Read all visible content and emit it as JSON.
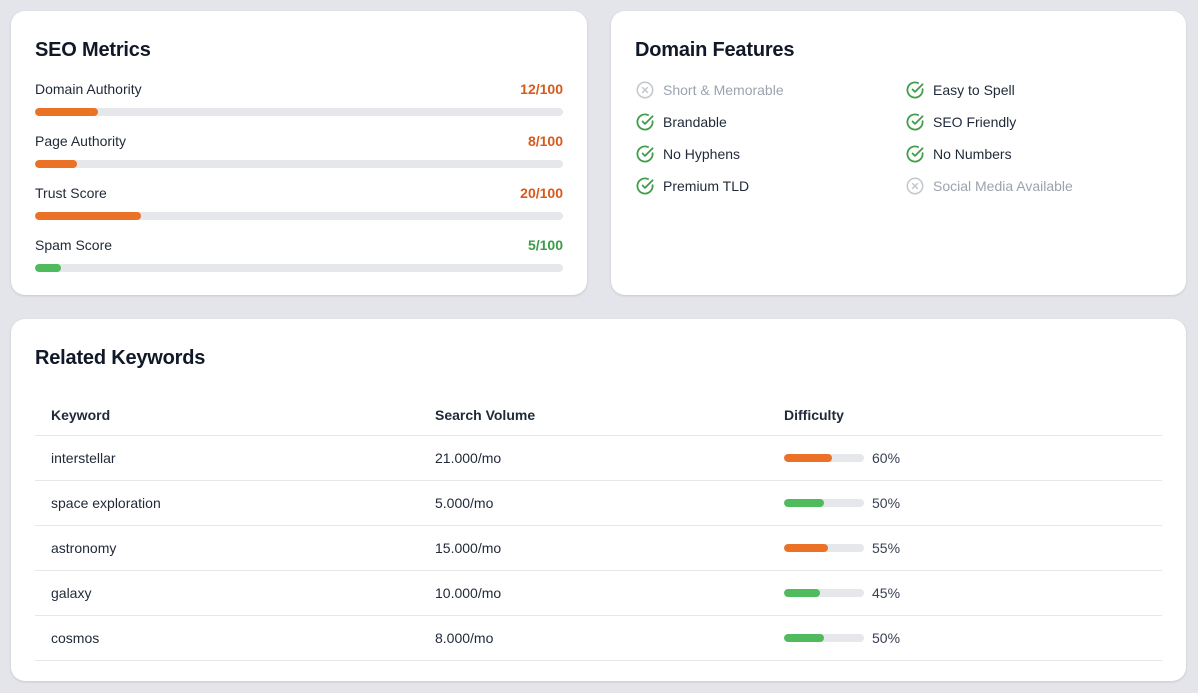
{
  "colors": {
    "orange": "#ea7125",
    "green": "#4fbb5c",
    "value_orange": "#d9591a",
    "value_green": "#3b9b47",
    "check_green": "#3f9e4a",
    "x_gray": "#c3c6cc"
  },
  "seo": {
    "title": "SEO Metrics",
    "metrics": [
      {
        "label": "Domain Authority",
        "value_text": "12/100",
        "value": 12,
        "status": "orange"
      },
      {
        "label": "Page Authority",
        "value_text": "8/100",
        "value": 8,
        "status": "orange"
      },
      {
        "label": "Trust Score",
        "value_text": "20/100",
        "value": 20,
        "status": "orange"
      },
      {
        "label": "Spam Score",
        "value_text": "5/100",
        "value": 5,
        "status": "green"
      }
    ]
  },
  "features": {
    "title": "Domain Features",
    "items": [
      {
        "label": "Short & Memorable",
        "available": false,
        "icon": "x-circle-icon"
      },
      {
        "label": "Easy to Spell",
        "available": true,
        "icon": "check-circle-icon"
      },
      {
        "label": "Brandable",
        "available": true,
        "icon": "check-circle-icon"
      },
      {
        "label": "SEO Friendly",
        "available": true,
        "icon": "check-circle-icon"
      },
      {
        "label": "No Hyphens",
        "available": true,
        "icon": "check-circle-icon"
      },
      {
        "label": "No Numbers",
        "available": true,
        "icon": "check-circle-icon"
      },
      {
        "label": "Premium TLD",
        "available": true,
        "icon": "check-circle-icon"
      },
      {
        "label": "Social Media Available",
        "available": false,
        "icon": "x-circle-icon"
      }
    ]
  },
  "keywords": {
    "title": "Related Keywords",
    "columns": [
      "Keyword",
      "Search Volume",
      "Difficulty"
    ],
    "rows": [
      {
        "keyword": "interstellar",
        "volume": "21.000/mo",
        "difficulty": 60,
        "difficulty_text": "60%",
        "status": "orange"
      },
      {
        "keyword": "space exploration",
        "volume": "5.000/mo",
        "difficulty": 50,
        "difficulty_text": "50%",
        "status": "green"
      },
      {
        "keyword": "astronomy",
        "volume": "15.000/mo",
        "difficulty": 55,
        "difficulty_text": "55%",
        "status": "orange"
      },
      {
        "keyword": "galaxy",
        "volume": "10.000/mo",
        "difficulty": 45,
        "difficulty_text": "45%",
        "status": "green"
      },
      {
        "keyword": "cosmos",
        "volume": "8.000/mo",
        "difficulty": 50,
        "difficulty_text": "50%",
        "status": "green"
      }
    ]
  }
}
